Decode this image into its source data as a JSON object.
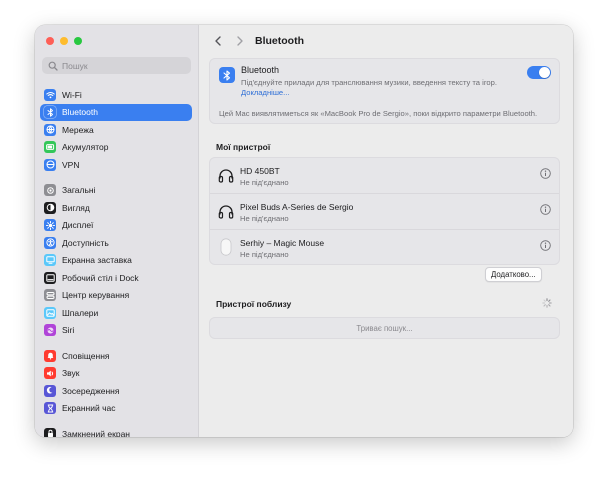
{
  "window": {
    "traffic_lights": [
      "#fe5f57",
      "#febc2e",
      "#28c840"
    ]
  },
  "sidebar": {
    "search_placeholder": "Пошук",
    "groups": [
      [
        {
          "label": "Wi-Fi",
          "icon": "wifi-icon",
          "color": "#3a7ff0",
          "active": false
        },
        {
          "label": "Bluetooth",
          "icon": "bluetooth-icon",
          "color": "#3a7ff0",
          "active": true
        },
        {
          "label": "Мережа",
          "icon": "globe-icon",
          "color": "#3a7ff0",
          "active": false
        },
        {
          "label": "Акумулятор",
          "icon": "battery-icon",
          "color": "#34c759",
          "active": false
        },
        {
          "label": "VPN",
          "icon": "vpn-icon",
          "color": "#3a7ff0",
          "active": false
        }
      ],
      [
        {
          "label": "Загальні",
          "icon": "gear-icon",
          "color": "#8e8e93",
          "active": false
        },
        {
          "label": "Вигляд",
          "icon": "appearance-icon",
          "color": "#1d1d1f",
          "active": false
        },
        {
          "label": "Дисплеї",
          "icon": "sun-icon",
          "color": "#3a7ff0",
          "active": false
        },
        {
          "label": "Доступність",
          "icon": "accessibility-icon",
          "color": "#3a7ff0",
          "active": false
        },
        {
          "label": "Екранна заставка",
          "icon": "screensaver-icon",
          "color": "#5ac8fa",
          "active": false
        },
        {
          "label": "Робочий стіл і Dock",
          "icon": "dock-icon",
          "color": "#1d1d1f",
          "active": false
        },
        {
          "label": "Центр керування",
          "icon": "control-center-icon",
          "color": "#8e8e93",
          "active": false
        },
        {
          "label": "Шпалери",
          "icon": "wallpaper-icon",
          "color": "#5ac8fa",
          "active": false
        },
        {
          "label": "Siri",
          "icon": "siri-icon",
          "color": "#b044d8",
          "active": false
        }
      ],
      [
        {
          "label": "Сповіщення",
          "icon": "bell-icon",
          "color": "#ff3b30",
          "active": false
        },
        {
          "label": "Звук",
          "icon": "speaker-icon",
          "color": "#ff3b30",
          "active": false
        },
        {
          "label": "Зосередження",
          "icon": "moon-icon",
          "color": "#5856d6",
          "active": false
        },
        {
          "label": "Екранний час",
          "icon": "hourglass-icon",
          "color": "#5856d6",
          "active": false
        }
      ],
      [
        {
          "label": "Замкнений екран",
          "icon": "lock-icon",
          "color": "#1d1d1f",
          "active": false
        }
      ]
    ]
  },
  "header": {
    "title": "Bluetooth"
  },
  "bluetooth_card": {
    "title": "Bluetooth",
    "description": "Під'єднуйте прилади для транслювання музики, введення тексту та ігор.",
    "link": "Докладніше...",
    "toggle_on": true,
    "note": "Цей Mac виявлятиметься як «MacBook Pro de Sergio», поки відкрито параметри Bluetooth."
  },
  "my_devices": {
    "title": "Мої пристрої",
    "devices": [
      {
        "name": "HD 450BT",
        "status": "Не під'єднано",
        "icon": "headphones-icon"
      },
      {
        "name": "Pixel Buds A-Series de Sergio",
        "status": "Не під'єднано",
        "icon": "headphones-icon"
      },
      {
        "name": "Serhiy – Magic Mouse",
        "status": "Не під'єднано",
        "icon": "mouse-icon"
      }
    ]
  },
  "buttons": {
    "advanced": "Додатково...",
    "help": "?"
  },
  "nearby": {
    "title": "Пристрої поблизу",
    "searching": "Триває пошук..."
  }
}
